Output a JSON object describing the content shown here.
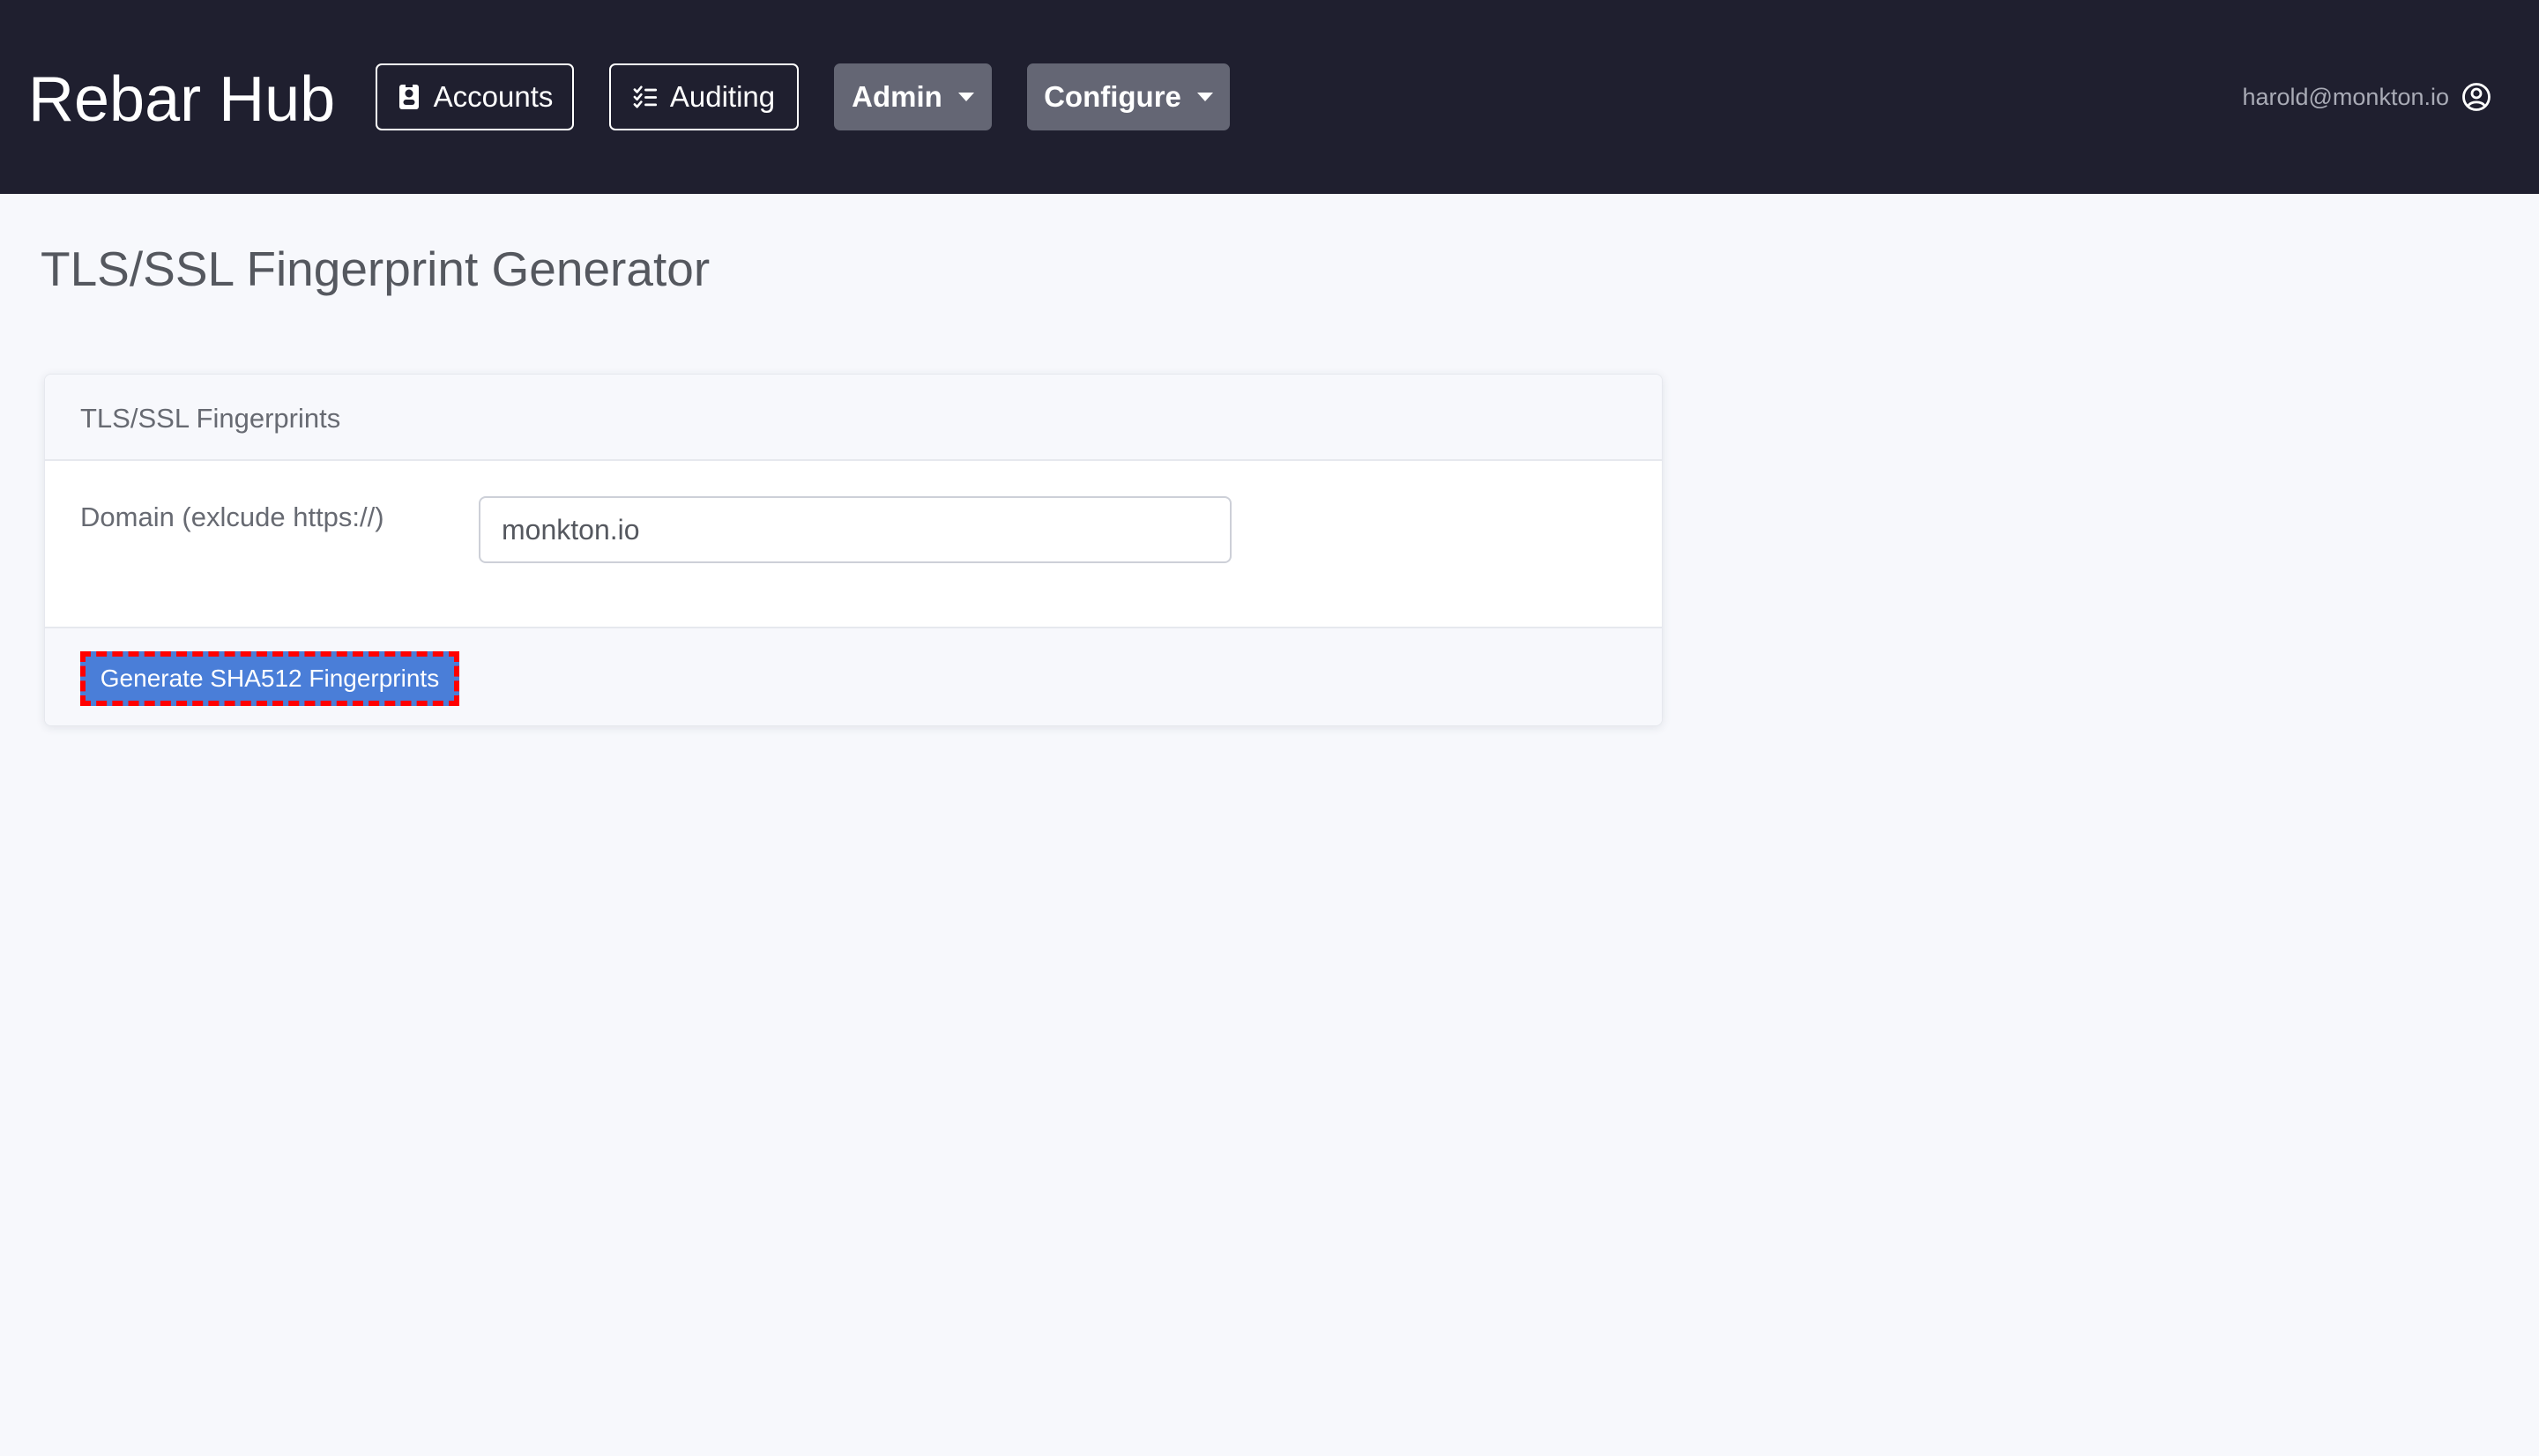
{
  "navbar": {
    "brand": "Rebar Hub",
    "items": [
      {
        "label": "Accounts",
        "icon": "id-badge-icon",
        "style": "outline"
      },
      {
        "label": "Auditing",
        "icon": "checklist-icon",
        "style": "outline"
      },
      {
        "label": "Admin",
        "icon": "chevron-down-icon",
        "style": "dropdown"
      },
      {
        "label": "Configure",
        "icon": "chevron-down-icon",
        "style": "dropdown"
      }
    ],
    "user": {
      "email": "harold@monkton.io",
      "icon": "user-circle-icon"
    }
  },
  "page": {
    "title": "TLS/SSL Fingerprint Generator"
  },
  "card": {
    "header": "TLS/SSL Fingerprints",
    "domain_label": "Domain (exlcude https://)",
    "domain_value": "monkton.io",
    "generate_label": "Generate SHA512 Fingerprints"
  },
  "colors": {
    "navbar_bg": "#1f1f2f",
    "page_bg": "#f7f8fc",
    "dropdown_bg": "#646674",
    "primary_button": "#4a7ed8",
    "highlight_border": "#ff0000"
  }
}
